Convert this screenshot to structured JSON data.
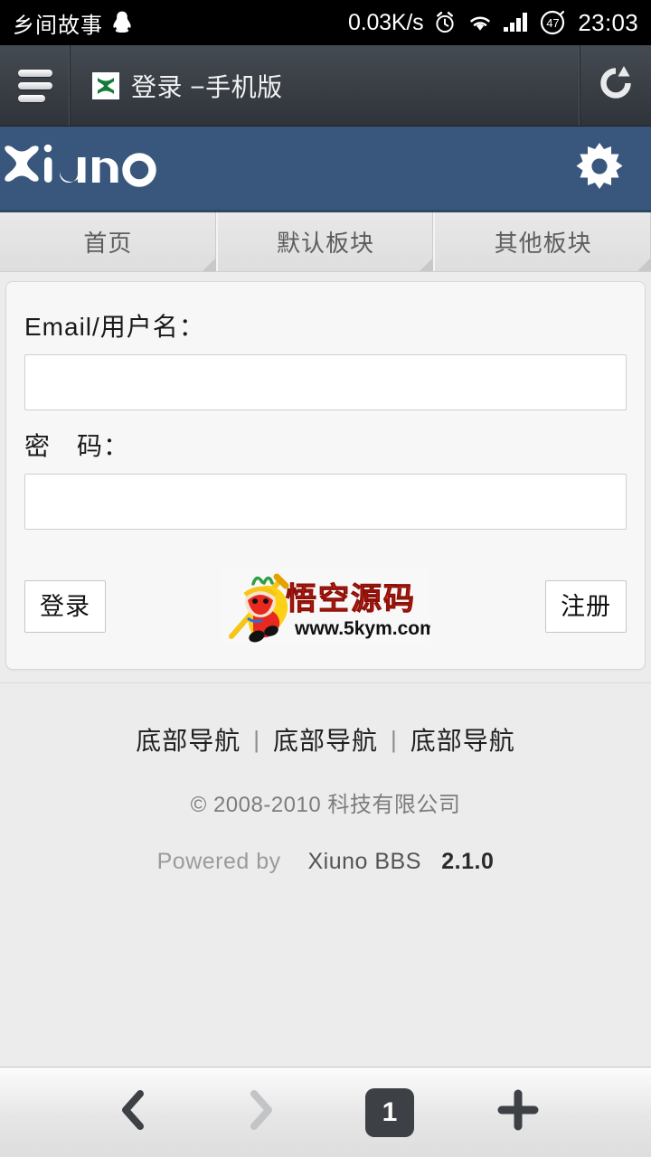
{
  "status_bar": {
    "carrier": "乡间故事",
    "qq_icon": "qq-penguin-icon",
    "network_speed": "0.03K/s",
    "alarm_icon": "alarm-clock-icon",
    "wifi_icon": "wifi-icon",
    "signal_icon": "cellular-signal-icon",
    "battery_level": "47",
    "time": "23:03"
  },
  "browser_titlebar": {
    "menu_icon": "hamburger-menu-icon",
    "favicon": "xiuno-x-favicon",
    "page_title": "登录 −手机版",
    "reload_icon": "reload-icon"
  },
  "site_header": {
    "logo_text": "Xiuno",
    "settings_icon": "gear-icon",
    "background_color": "#39577d"
  },
  "nav_tabs": [
    {
      "label": "首页"
    },
    {
      "label": "默认板块"
    },
    {
      "label": "其他板块"
    }
  ],
  "login_form": {
    "username": {
      "label": "Email/用户名：",
      "value": "",
      "placeholder": ""
    },
    "password": {
      "label": "密　码：",
      "value": "",
      "placeholder": ""
    },
    "login_button": "登录",
    "register_button": "注册",
    "watermark": {
      "brand_text": "悟空源码",
      "url_text": "www.5kym.com",
      "brand_color": "#e8291f"
    }
  },
  "footer": {
    "nav": [
      "底部导航",
      "底部导航",
      "底部导航"
    ],
    "separator": "|",
    "copyright": "© 2008-2010 科技有限公司",
    "powered_prefix": "Powered by",
    "powered_product": "Xiuno BBS",
    "powered_version": "2.1.0"
  },
  "bottom_bar": {
    "back_icon": "chevron-left-icon",
    "forward_icon": "chevron-right-icon",
    "tab_count": "1",
    "new_tab_icon": "plus-icon"
  }
}
